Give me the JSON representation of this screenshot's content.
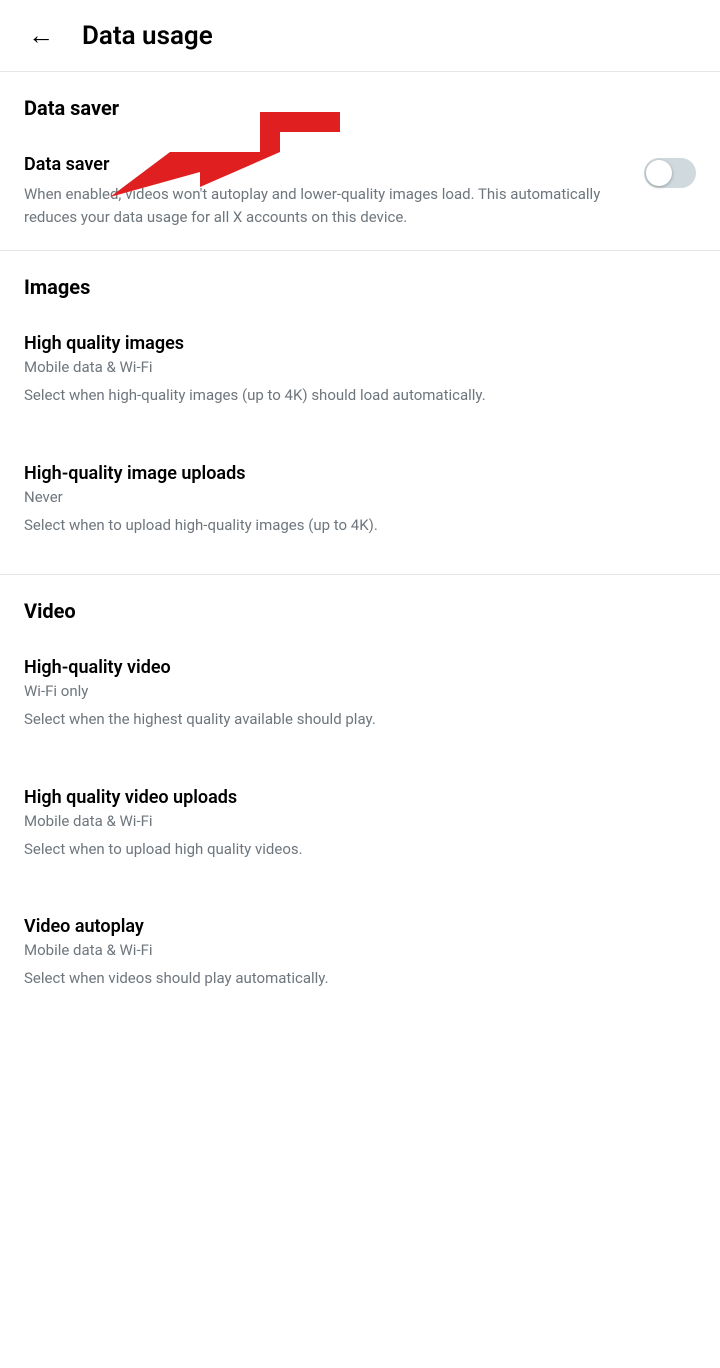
{
  "header": {
    "title": "Data usage",
    "back_label": "←"
  },
  "sections": [
    {
      "id": "data-saver",
      "header": "Data saver",
      "settings": [
        {
          "id": "data-saver-toggle",
          "title": "Data saver",
          "subtitle": "",
          "description": "When enabled, videos won't autoplay and lower-quality images load. This automatically reduces your data usage for all X accounts on this device.",
          "has_toggle": true,
          "toggle_on": false,
          "value": ""
        }
      ]
    },
    {
      "id": "images",
      "header": "Images",
      "settings": [
        {
          "id": "high-quality-images",
          "title": "High quality images",
          "subtitle": "Mobile data & Wi-Fi",
          "description": "Select when high-quality images (up to 4K) should load automatically.",
          "has_toggle": false,
          "toggle_on": false,
          "value": "Mobile data & Wi-Fi"
        },
        {
          "id": "high-quality-image-uploads",
          "title": "High-quality image uploads",
          "subtitle": "Never",
          "description": "Select when to upload high-quality images (up to 4K).",
          "has_toggle": false,
          "toggle_on": false,
          "value": "Never"
        }
      ]
    },
    {
      "id": "video",
      "header": "Video",
      "settings": [
        {
          "id": "high-quality-video",
          "title": "High-quality video",
          "subtitle": "Wi-Fi only",
          "description": "Select when the highest quality available should play.",
          "has_toggle": false,
          "toggle_on": false,
          "value": "Wi-Fi only"
        },
        {
          "id": "high-quality-video-uploads",
          "title": "High quality video uploads",
          "subtitle": "Mobile data & Wi-Fi",
          "description": "Select when to upload high quality videos.",
          "has_toggle": false,
          "toggle_on": false,
          "value": "Mobile data & Wi-Fi"
        },
        {
          "id": "video-autoplay",
          "title": "Video autoplay",
          "subtitle": "Mobile data & Wi-Fi",
          "description": "Select when videos should play automatically.",
          "has_toggle": false,
          "toggle_on": false,
          "value": "Mobile data & Wi-Fi"
        }
      ]
    }
  ],
  "arrow": {
    "visible": true
  }
}
